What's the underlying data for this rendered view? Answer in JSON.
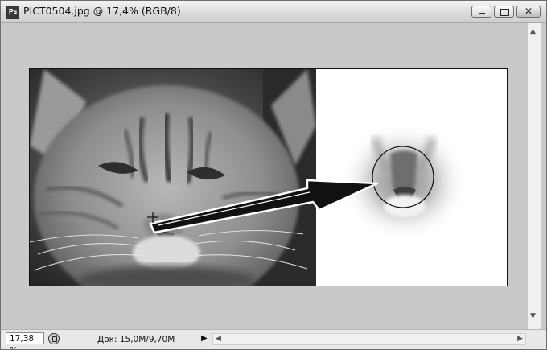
{
  "window": {
    "title": "PICT0504.jpg @ 17,4% (RGB/8)",
    "app_icon_text": "Ps",
    "close_glyph": "✕"
  },
  "status": {
    "zoom": "17,38 %",
    "doc_info": "Док: 15,0M/9,70M",
    "info_arrow": "▶"
  },
  "scroll": {
    "up": "▲",
    "down": "▼",
    "left": "◀",
    "right": "▶"
  },
  "icons": {
    "app": "photoshop-icon",
    "status": "timer-icon",
    "cursor": "crosshair-icon"
  },
  "colors": {
    "workspace": "#c9c9c9",
    "frame": "#6e6e6e",
    "canvas_border": "#111111"
  }
}
